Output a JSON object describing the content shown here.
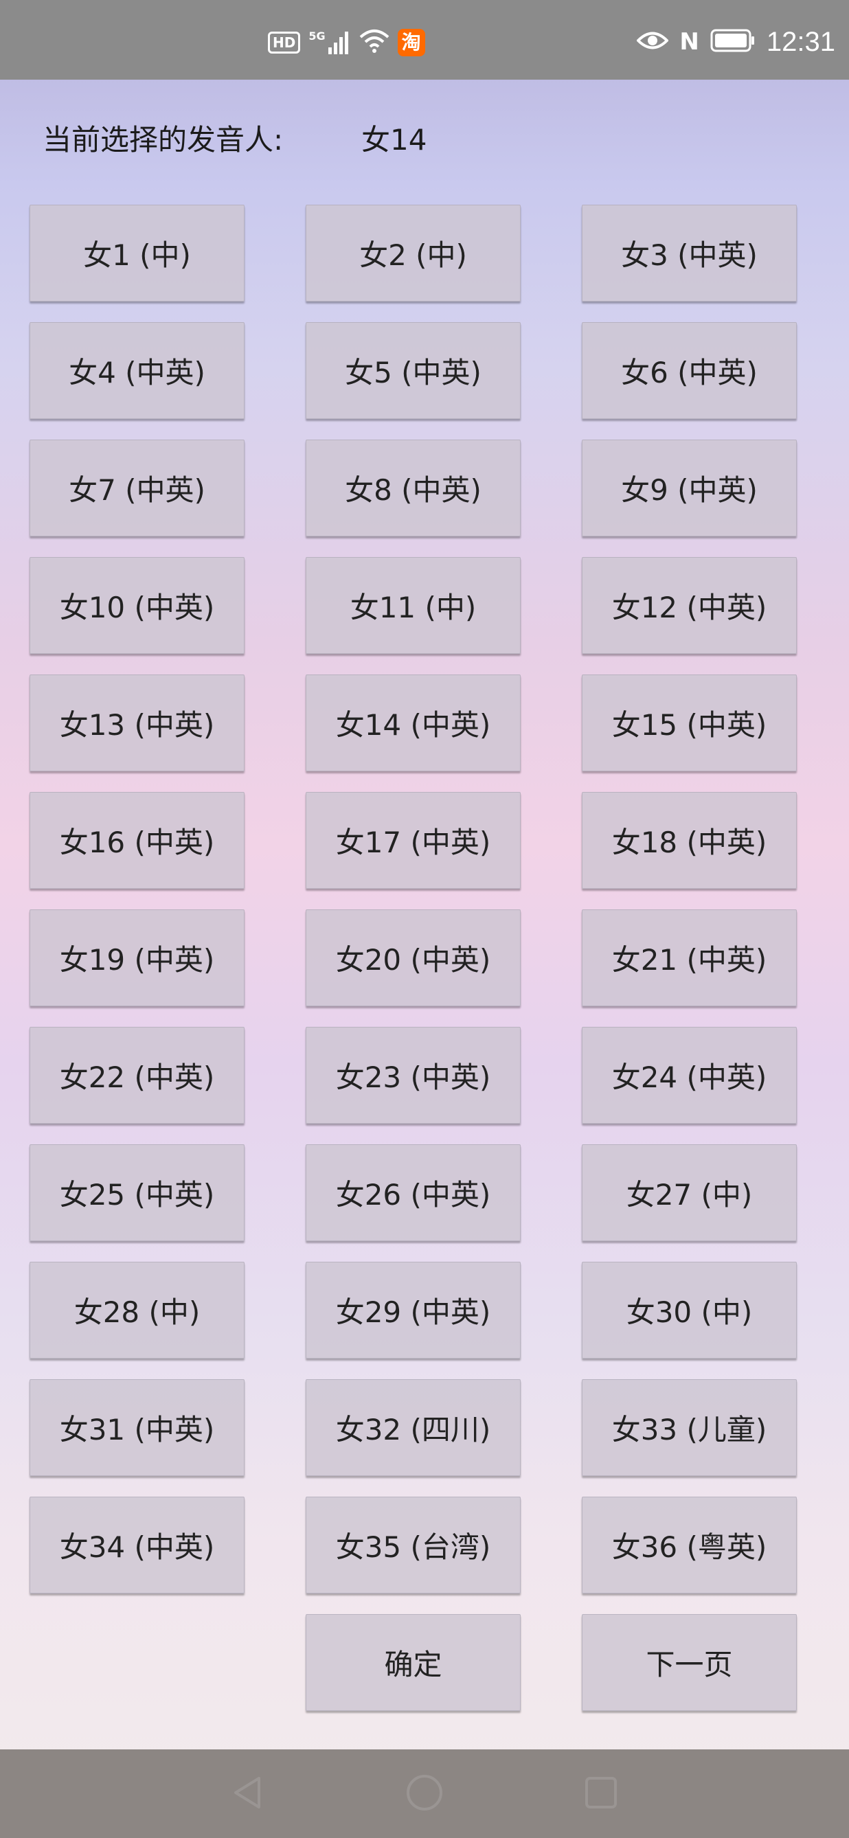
{
  "status_bar": {
    "hd": "HD",
    "net": "5G",
    "time": "12:31",
    "nfc": "N"
  },
  "header": {
    "label": "当前选择的发音人:",
    "selected": "女14"
  },
  "voices": [
    "女1 (中)",
    "女2 (中)",
    "女3 (中英)",
    "女4 (中英)",
    "女5 (中英)",
    "女6 (中英)",
    "女7 (中英)",
    "女8 (中英)",
    "女9 (中英)",
    "女10 (中英)",
    "女11 (中)",
    "女12 (中英)",
    "女13 (中英)",
    "女14 (中英)",
    "女15 (中英)",
    "女16 (中英)",
    "女17 (中英)",
    "女18 (中英)",
    "女19 (中英)",
    "女20 (中英)",
    "女21 (中英)",
    "女22 (中英)",
    "女23 (中英)",
    "女24 (中英)",
    "女25 (中英)",
    "女26 (中英)",
    "女27 (中)",
    "女28 (中)",
    "女29 (中英)",
    "女30 (中)",
    "女31 (中英)",
    "女32 (四川)",
    "女33 (儿童)",
    "女34 (中英)",
    "女35 (台湾)",
    "女36 (粤英)"
  ],
  "actions": {
    "confirm": "确定",
    "next_page": "下一页"
  }
}
